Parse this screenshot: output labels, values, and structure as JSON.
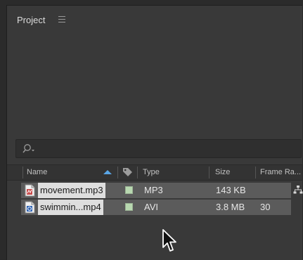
{
  "panel": {
    "title": "Project"
  },
  "search": {
    "placeholder": ""
  },
  "columns": {
    "name": "Name",
    "type": "Type",
    "size": "Size",
    "frame_rate": "Frame Ra..."
  },
  "files": [
    {
      "name": "movement.mp3",
      "icon": "audio-file-icon",
      "label_color": "#b8d8b0",
      "type": "MP3",
      "size": "143 KB",
      "frame_rate": ""
    },
    {
      "name": "swimmin...mp4",
      "icon": "video-file-icon",
      "label_color": "#b8d8b0",
      "type": "AVI",
      "size": "3.8 MB",
      "frame_rate": "30"
    }
  ],
  "colors": {
    "panel_bg": "#393939",
    "row_bg": "#5b5b5b",
    "selected_name_bg": "#dedede",
    "sort_arrow": "#5aa6e6"
  }
}
